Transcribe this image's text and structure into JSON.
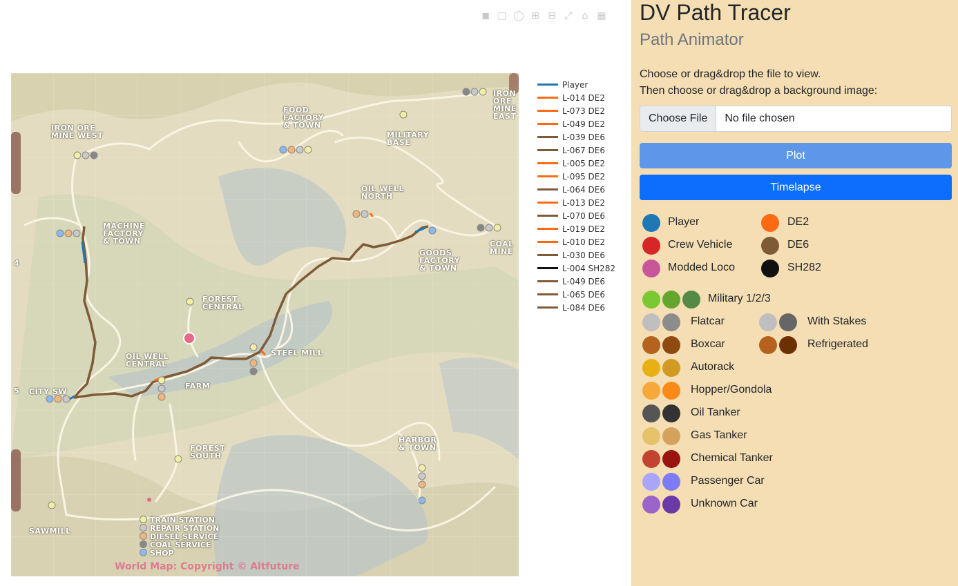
{
  "modebar": {
    "icons": [
      "camera-icon",
      "zoom-icon",
      "lasso-icon",
      "zoom-in-icon",
      "zoom-out-icon",
      "autoscale-icon",
      "home-icon",
      "plotly-logo-icon"
    ]
  },
  "map": {
    "labels": [
      {
        "id": "iron-ore-mine-west",
        "text": "IRON ORE\nMINE WEST"
      },
      {
        "id": "food-factory",
        "text": "FOOD\nFACTORY\n& TOWN"
      },
      {
        "id": "military-base",
        "text": "MILITARY\nBASE"
      },
      {
        "id": "iron-ore-mine-east",
        "text": "IRON\nORE\nMINE\nEAST"
      },
      {
        "id": "oil-well-north",
        "text": "OIL WELL\nNORTH"
      },
      {
        "id": "machine-factory",
        "text": "MACHINE\nFACTORY\n& TOWN"
      },
      {
        "id": "coal-mine",
        "text": "COAL\nMINE"
      },
      {
        "id": "goods-factory",
        "text": "GOODS\nFACTORY\n& TOWN"
      },
      {
        "id": "forest-central",
        "text": "FOREST\nCENTRAL"
      },
      {
        "id": "oil-well-central",
        "text": "OIL WELL\nCENTRAL"
      },
      {
        "id": "steel-mill",
        "text": "STEEL MILL"
      },
      {
        "id": "farm",
        "text": "FARM"
      },
      {
        "id": "city-sw",
        "text": "CITY SW"
      },
      {
        "id": "forest-south",
        "text": "FOREST\nSOUTH"
      },
      {
        "id": "harbor",
        "text": "HARBOR\n& TOWN"
      },
      {
        "id": "sawmill",
        "text": "SAWMILL"
      }
    ],
    "grid_numbers": [
      "4",
      "5"
    ],
    "key": [
      {
        "label": "TRAIN STATION",
        "color": "#f2f0a0"
      },
      {
        "label": "REPAIR STATION",
        "color": "#c9c9c9"
      },
      {
        "label": "DIESEL SERVICE",
        "color": "#f4b57a"
      },
      {
        "label": "COAL SERVICE",
        "color": "#888888"
      },
      {
        "label": "SHOP",
        "color": "#8cb8f2"
      }
    ],
    "copyright": "World Map: Copyright © Altfuture"
  },
  "legend": [
    {
      "name": "Player",
      "color": "#1f77b4"
    },
    {
      "name": "L-014 DE2",
      "color": "#ff6a13"
    },
    {
      "name": "L-073 DE2",
      "color": "#ff6a13"
    },
    {
      "name": "L-049 DE2",
      "color": "#ff6a13"
    },
    {
      "name": "L-039 DE6",
      "color": "#7f5a36"
    },
    {
      "name": "L-067 DE6",
      "color": "#7f5a36"
    },
    {
      "name": "L-005 DE2",
      "color": "#ff6a13"
    },
    {
      "name": "L-095 DE2",
      "color": "#ff6a13"
    },
    {
      "name": "L-064 DE6",
      "color": "#7f5a36"
    },
    {
      "name": "L-013 DE2",
      "color": "#ff6a13"
    },
    {
      "name": "L-070 DE6",
      "color": "#7f5a36"
    },
    {
      "name": "L-019 DE2",
      "color": "#ff6a13"
    },
    {
      "name": "L-010 DE2",
      "color": "#ff6a13"
    },
    {
      "name": "L-030 DE6",
      "color": "#7f5a36"
    },
    {
      "name": "L-004 SH282",
      "color": "#111111"
    },
    {
      "name": "L-049 DE6",
      "color": "#7f5a36"
    },
    {
      "name": "L-065 DE6",
      "color": "#7f5a36"
    },
    {
      "name": "L-084 DE6",
      "color": "#7f5a36"
    }
  ],
  "sidebar": {
    "title": "DV Path Tracer",
    "subtitle": "Path Animator",
    "instruction1": "Choose or drag&drop the file to view.",
    "instruction2": "Then choose or drag&drop a background image:",
    "file_button": "Choose File",
    "file_status": "No file chosen",
    "plot_button": "Plot",
    "timelapse_button": "Timelapse",
    "loco_legend": [
      {
        "label": "Player",
        "color": "#1f77b4"
      },
      {
        "label": "Crew Vehicle",
        "color": "#d62728"
      },
      {
        "label": "Modded Loco",
        "color": "#c8569a"
      },
      {
        "label": "DE2",
        "color": "#ff6a13"
      },
      {
        "label": "DE6",
        "color": "#7f5a36"
      },
      {
        "label": "SH282",
        "color": "#111111"
      }
    ],
    "military": {
      "label": "Military 1/2/3",
      "colors": [
        "#7ac832",
        "#64a62d",
        "#548a45"
      ]
    },
    "cars": [
      {
        "label": "Flatcar",
        "colors": [
          "#c0bfbf",
          "#8c8c8c"
        ]
      },
      {
        "label": "Boxcar",
        "colors": [
          "#b5621f",
          "#8f4a0f"
        ]
      },
      {
        "label": "Autorack",
        "colors": [
          "#e8b010",
          "#d19a22"
        ]
      },
      {
        "label": "Hopper/Gondola",
        "colors": [
          "#f7a83a",
          "#f98a1a"
        ]
      },
      {
        "label": "Oil Tanker",
        "colors": [
          "#555555",
          "#333333"
        ]
      },
      {
        "label": "Gas Tanker",
        "colors": [
          "#e6c26a",
          "#d5a25e"
        ]
      },
      {
        "label": "Chemical Tanker",
        "colors": [
          "#c2432f",
          "#9a1410"
        ]
      },
      {
        "label": "Passenger Car",
        "colors": [
          "#a9a5fb",
          "#7d7bf6"
        ]
      },
      {
        "label": "Unknown Car",
        "colors": [
          "#9a64c9",
          "#6c3aa6"
        ]
      }
    ],
    "cars_right": [
      {
        "label": "With Stakes",
        "colors": [
          "#c0bfbf",
          "#666666"
        ]
      },
      {
        "label": "Refrigerated",
        "colors": [
          "#b5621f",
          "#6b3004"
        ]
      }
    ]
  }
}
